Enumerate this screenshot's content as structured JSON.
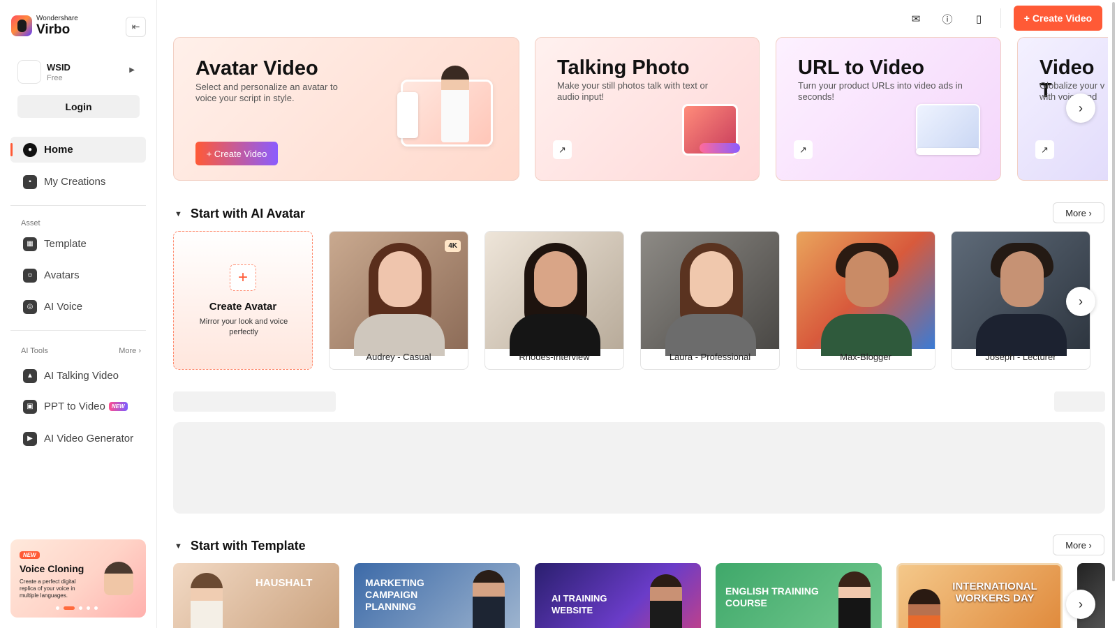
{
  "app": {
    "brand_small": "Wondershare",
    "brand_name": "Virbo"
  },
  "user": {
    "name": "WSID",
    "plan": "Free",
    "login_label": "Login"
  },
  "nav": {
    "main": [
      {
        "label": "Home",
        "icon": "home-icon"
      },
      {
        "label": "My Creations",
        "icon": "creations-icon"
      }
    ],
    "asset_label": "Asset",
    "asset": [
      {
        "label": "Template",
        "icon": "template-icon"
      },
      {
        "label": "Avatars",
        "icon": "avatar-icon"
      },
      {
        "label": "AI Voice",
        "icon": "voice-icon"
      }
    ],
    "ai_tools_label": "AI Tools",
    "ai_tools_more": "More",
    "ai_tools": [
      {
        "label": "AI Talking Video",
        "icon": "talking-video-icon"
      },
      {
        "label": "PPT to Video",
        "icon": "ppt-icon",
        "badge": "NEW"
      },
      {
        "label": "AI Video Generator",
        "icon": "video-generator-icon"
      }
    ]
  },
  "promo": {
    "badge": "NEW",
    "title": "Voice Cloning",
    "description": "Create a perfect digital replica of your voice in multiple languages."
  },
  "topbar": {
    "create_label": "+ Create Video",
    "accent": "#ff5a36"
  },
  "features": [
    {
      "title": "Avatar Video",
      "description": "Select and personalize an avatar to voice your script in style.",
      "button": "+ Create Video"
    },
    {
      "title": "Talking Photo",
      "description": "Make your still photos talk with text or audio input!"
    },
    {
      "title": "URL to Video",
      "description": "Turn your product URLs into video ads in seconds!"
    },
    {
      "title": "Video T",
      "description": "Globalize your v with voice and"
    }
  ],
  "avatar_section": {
    "title": "Start with AI Avatar",
    "more": "More",
    "create_title": "Create Avatar",
    "create_desc": "Mirror your look and voice perfectly",
    "badge": "4K",
    "avatars": [
      "Audrey - Casual",
      "Rhodes-Interview",
      "Laura - Professional",
      "Max-Blogger",
      "Joseph - Lecturer"
    ]
  },
  "template_section": {
    "title": "Start with Template",
    "more": "More",
    "templates": [
      "HAUSHALT",
      "MARKETING CAMPAIGN PLANNING",
      "AI TRAINING WEBSITE",
      "ENGLISH TRAINING COURSE",
      "INTERNATIONAL WORKERS DAY"
    ]
  }
}
